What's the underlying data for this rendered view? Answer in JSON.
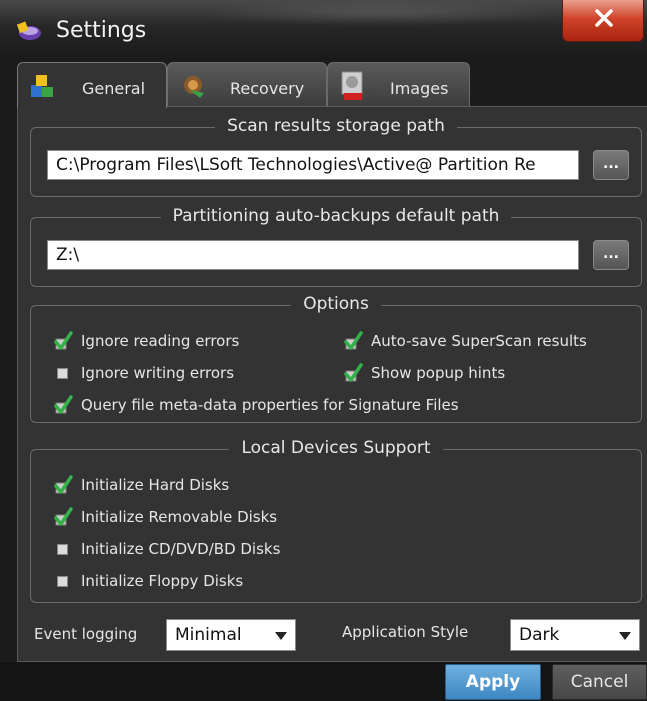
{
  "window": {
    "title": "Settings",
    "accent": "#3d86c2",
    "close_color": "#d0442a"
  },
  "tabs": [
    {
      "label": "General",
      "icon": "blocks-icon",
      "active": true
    },
    {
      "label": "Recovery",
      "icon": "recovery-icon",
      "active": false
    },
    {
      "label": "Images",
      "icon": "disk-image-icon",
      "active": false
    }
  ],
  "scan_path": {
    "title": "Scan results storage path",
    "value": "C:\\Program Files\\LSoft Technologies\\Active@ Partition Re",
    "browse_label": "..."
  },
  "backup_path": {
    "title": "Partitioning auto-backups default path",
    "value": "Z:\\",
    "browse_label": "..."
  },
  "options": {
    "title": "Options",
    "items": [
      {
        "label": "Ignore reading errors",
        "checked": true
      },
      {
        "label": "Auto-save SuperScan results",
        "checked": true
      },
      {
        "label": "Ignore writing errors",
        "checked": false
      },
      {
        "label": "Show popup hints",
        "checked": true
      },
      {
        "label": "Query file meta-data properties for Signature Files",
        "checked": true
      }
    ]
  },
  "devices": {
    "title": "Local Devices Support",
    "items": [
      {
        "label": "Initialize Hard Disks",
        "checked": true
      },
      {
        "label": "Initialize Removable Disks",
        "checked": true
      },
      {
        "label": "Initialize CD/DVD/BD Disks",
        "checked": false
      },
      {
        "label": "Initialize Floppy Disks",
        "checked": false
      }
    ]
  },
  "event_logging": {
    "label": "Event logging",
    "value": "Minimal"
  },
  "app_style": {
    "label": "Application Style",
    "value": "Dark"
  },
  "buttons": {
    "apply": "Apply",
    "cancel": "Cancel"
  }
}
